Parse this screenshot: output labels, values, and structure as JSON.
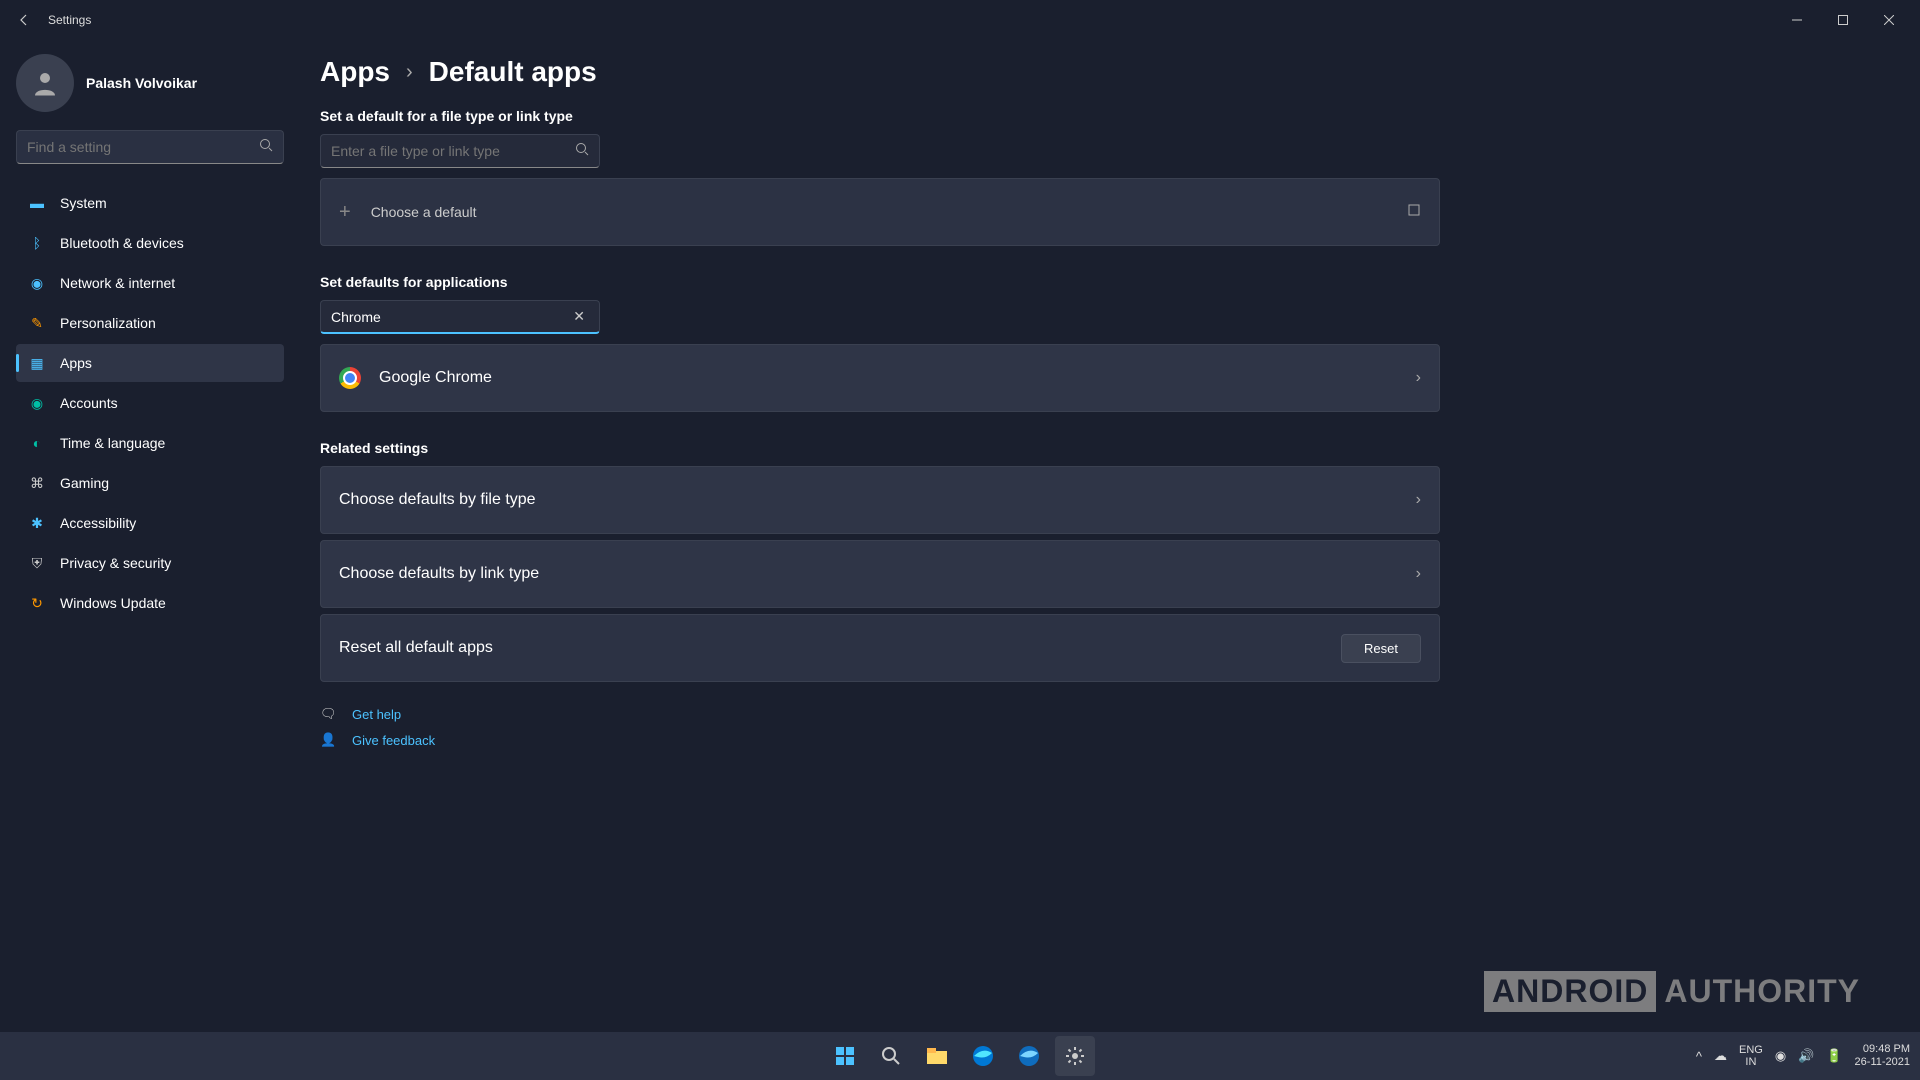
{
  "titlebar": {
    "title": "Settings"
  },
  "profile": {
    "name": "Palash Volvoikar"
  },
  "search": {
    "placeholder": "Find a setting"
  },
  "sidebar": {
    "items": [
      {
        "label": "System",
        "color": "#4cc2ff"
      },
      {
        "label": "Bluetooth & devices",
        "color": "#4cc2ff"
      },
      {
        "label": "Network & internet",
        "color": "#4cc2ff"
      },
      {
        "label": "Personalization",
        "color": "#ff9800"
      },
      {
        "label": "Apps",
        "color": "#4cc2ff"
      },
      {
        "label": "Accounts",
        "color": "#00bfa5"
      },
      {
        "label": "Time & language",
        "color": "#00bfa5"
      },
      {
        "label": "Gaming",
        "color": "#ccc"
      },
      {
        "label": "Accessibility",
        "color": "#4cc2ff"
      },
      {
        "label": "Privacy & security",
        "color": "#ccc"
      },
      {
        "label": "Windows Update",
        "color": "#ff9800"
      }
    ]
  },
  "breadcrumb": {
    "parent": "Apps",
    "current": "Default apps"
  },
  "sections": {
    "filetype_label": "Set a default for a file type or link type",
    "filetype_placeholder": "Enter a file type or link type",
    "choose_default": "Choose a default",
    "apps_label": "Set defaults for applications",
    "apps_search_value": "Chrome",
    "app_result": "Google Chrome",
    "related_label": "Related settings",
    "by_file": "Choose defaults by file type",
    "by_link": "Choose defaults by link type",
    "reset_label": "Reset all default apps",
    "reset_btn": "Reset"
  },
  "help": {
    "get_help": "Get help",
    "give_feedback": "Give feedback"
  },
  "watermark": {
    "boxed": "ANDROID",
    "plain": "AUTHORITY"
  },
  "tray": {
    "lang1": "ENG",
    "lang2": "IN",
    "time": "09:48 PM",
    "date": "26-11-2021"
  }
}
